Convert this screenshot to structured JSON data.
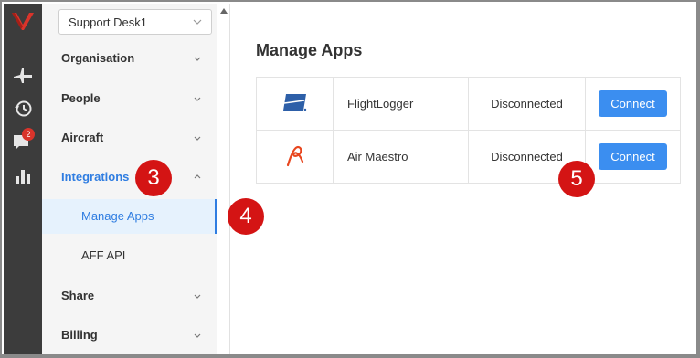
{
  "sidebar": {
    "workspace_select": "Support Desk1",
    "notification_count": "2",
    "items": [
      {
        "label": "Organisation"
      },
      {
        "label": "People"
      },
      {
        "label": "Aircraft"
      },
      {
        "label": "Integrations"
      },
      {
        "label": "Share"
      },
      {
        "label": "Billing"
      }
    ],
    "subitems": [
      {
        "label": "Manage Apps"
      },
      {
        "label": "AFF API"
      }
    ]
  },
  "main": {
    "title": "Manage Apps",
    "apps": [
      {
        "name": "FlightLogger",
        "status": "Disconnected",
        "action": "Connect",
        "logo_icon": "flightlogger-logo-icon"
      },
      {
        "name": "Air Maestro",
        "status": "Disconnected",
        "action": "Connect",
        "logo_icon": "air-maestro-logo-icon"
      }
    ]
  },
  "annotations": {
    "step3": "3",
    "step4": "4",
    "step5": "5"
  },
  "colors": {
    "accent": "#2f7de1",
    "button": "#3b8ef0",
    "rail": "#3c3c3c",
    "step_marker": "#d41414",
    "brand_red": "#d9342b"
  }
}
